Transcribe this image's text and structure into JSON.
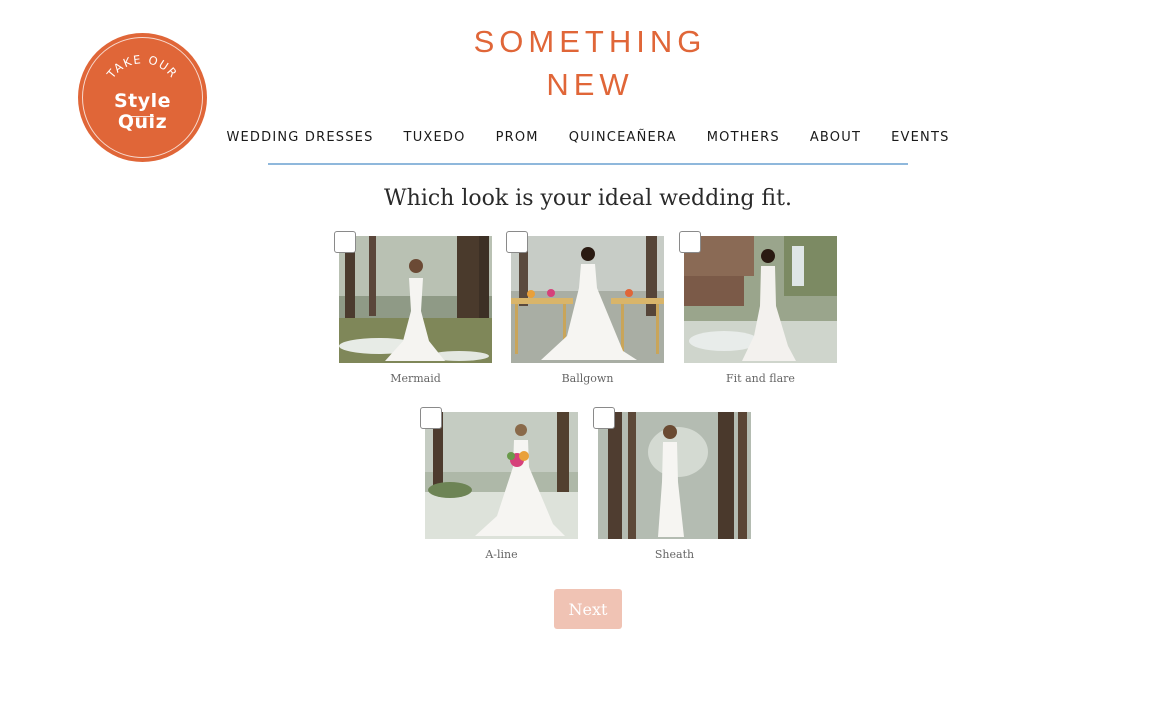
{
  "badge": {
    "arc_text": "TAKE OUR",
    "line1": "Style",
    "line2": "Quiz"
  },
  "logo": {
    "line1": "SOMETHING",
    "line2": "NEW"
  },
  "nav": [
    "WEDDING DRESSES",
    "TUXEDO",
    "PROM",
    "QUINCEAÑERA",
    "MOTHERS",
    "ABOUT",
    "EVENTS"
  ],
  "quiz": {
    "question": "Which look is your ideal wedding fit.",
    "options": [
      {
        "label": "Mermaid",
        "checked": false
      },
      {
        "label": "Ballgown",
        "checked": false
      },
      {
        "label": "Fit and flare",
        "checked": false
      },
      {
        "label": "A-line",
        "checked": false
      },
      {
        "label": "Sheath",
        "checked": false
      }
    ],
    "next_label": "Next"
  },
  "colors": {
    "brand": "#e06638",
    "nav_rule": "#8fb8dc",
    "next_button": "#f0c3b4"
  }
}
